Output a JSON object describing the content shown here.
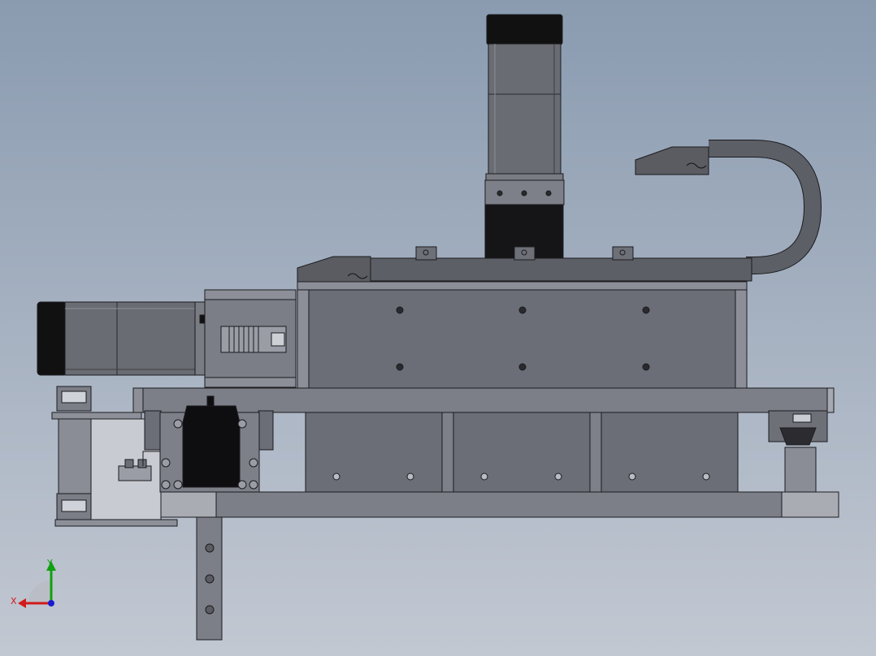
{
  "triad": {
    "x_label": "X",
    "y_label": "Y",
    "x_color": "#d11a1a",
    "y_color": "#10a010",
    "z_color": "#1a1ad1"
  },
  "colors": {
    "background_top": "#8a9bb0",
    "background_bottom": "#c2c8d2",
    "steel_dark": "#4e5058",
    "steel_mid": "#6c6f78",
    "steel_light": "#8d909a",
    "motor_cap": "#121212",
    "cable_chain": "#5a5c62"
  },
  "parts": {
    "vertical_motor": "servo-motor",
    "horizontal_motor": "servo-motor",
    "coupling": "shaft-coupling",
    "cable_chain": "drag-chain",
    "carriage_block": "slide-carriage",
    "base_frame": "base-frame",
    "bearing_block": "linear-bearing"
  }
}
